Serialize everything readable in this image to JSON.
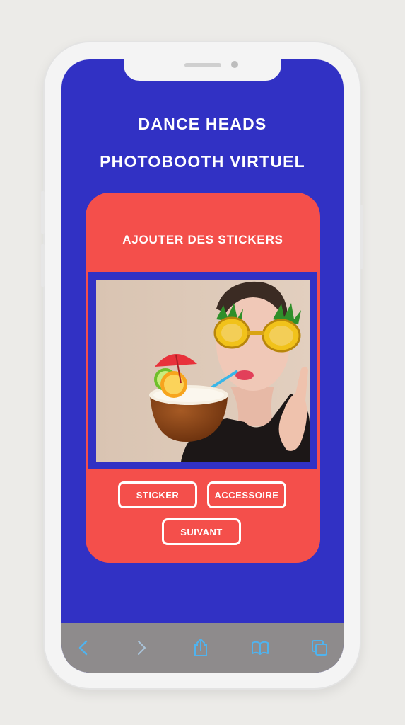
{
  "app": {
    "title_line1": "DANCE HEADS",
    "title_line2": "PHOTOBOOTH VIRTUEL"
  },
  "card": {
    "heading": "AJOUTER DES STICKERS"
  },
  "photo": {
    "stickers": [
      "pineapple-glasses",
      "coconut-cocktail",
      "drink-umbrella",
      "straw"
    ]
  },
  "buttons": {
    "sticker": "STICKER",
    "accessoire": "ACCESSOIRE",
    "suivant": "SUIVANT"
  },
  "browser_toolbar": {
    "icons": [
      "back-icon",
      "forward-icon",
      "share-icon",
      "bookmarks-icon",
      "tabs-icon"
    ]
  },
  "colors": {
    "background": "#3131c4",
    "card": "#f44f4b",
    "text": "#ffffff",
    "toolbar": "#8e8b8c",
    "toolbar_icon_active": "#4fb3ef",
    "toolbar_icon_disabled": "#a9c3d8"
  }
}
